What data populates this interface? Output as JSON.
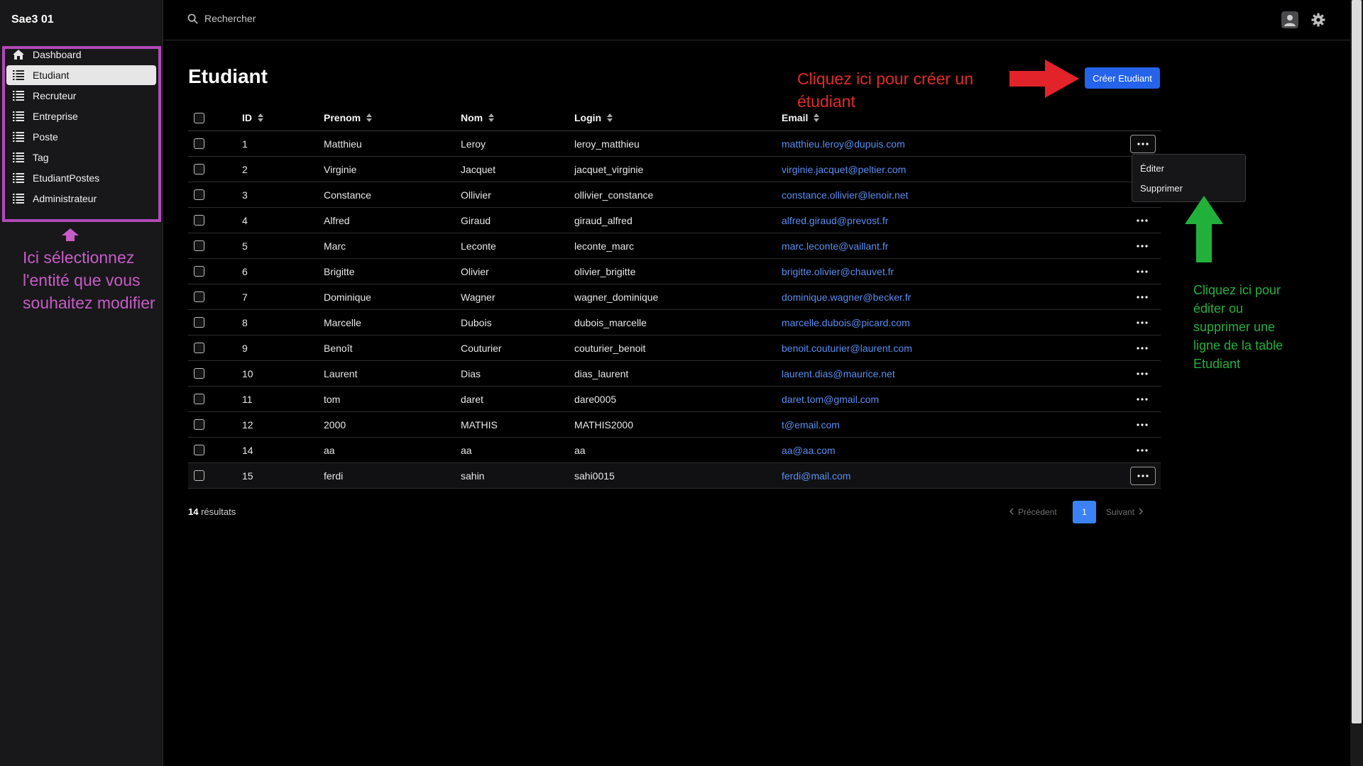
{
  "app": {
    "title": "Sae3 01"
  },
  "search": {
    "label": "Rechercher"
  },
  "sidebar": {
    "items": [
      {
        "label": "Dashboard",
        "icon": "home-icon"
      },
      {
        "label": "Etudiant",
        "icon": "list-icon",
        "active": true
      },
      {
        "label": "Recruteur",
        "icon": "list-icon"
      },
      {
        "label": "Entreprise",
        "icon": "list-icon"
      },
      {
        "label": "Poste",
        "icon": "list-icon"
      },
      {
        "label": "Tag",
        "icon": "list-icon"
      },
      {
        "label": "EtudiantPostes",
        "icon": "list-icon"
      },
      {
        "label": "Administrateur",
        "icon": "list-icon"
      }
    ]
  },
  "page": {
    "title": "Etudiant",
    "create_button": "Créer Etudiant"
  },
  "table": {
    "columns": [
      "ID",
      "Prenom",
      "Nom",
      "Login",
      "Email"
    ],
    "rows": [
      {
        "id": "1",
        "prenom": "Matthieu",
        "nom": "Leroy",
        "login": "leroy_matthieu",
        "email": "matthieu.leroy@dupuis.com"
      },
      {
        "id": "2",
        "prenom": "Virginie",
        "nom": "Jacquet",
        "login": "jacquet_virginie",
        "email": "virginie.jacquet@peltier.com"
      },
      {
        "id": "3",
        "prenom": "Constance",
        "nom": "Ollivier",
        "login": "ollivier_constance",
        "email": "constance.ollivier@lenoir.net"
      },
      {
        "id": "4",
        "prenom": "Alfred",
        "nom": "Giraud",
        "login": "giraud_alfred",
        "email": "alfred.giraud@prevost.fr"
      },
      {
        "id": "5",
        "prenom": "Marc",
        "nom": "Leconte",
        "login": "leconte_marc",
        "email": "marc.leconte@vaillant.fr"
      },
      {
        "id": "6",
        "prenom": "Brigitte",
        "nom": "Olivier",
        "login": "olivier_brigitte",
        "email": "brigitte.olivier@chauvet.fr"
      },
      {
        "id": "7",
        "prenom": "Dominique",
        "nom": "Wagner",
        "login": "wagner_dominique",
        "email": "dominique.wagner@becker.fr"
      },
      {
        "id": "8",
        "prenom": "Marcelle",
        "nom": "Dubois",
        "login": "dubois_marcelle",
        "email": "marcelle.dubois@picard.com"
      },
      {
        "id": "9",
        "prenom": "Benoît",
        "nom": "Couturier",
        "login": "couturier_benoit",
        "email": "benoit.couturier@laurent.com"
      },
      {
        "id": "10",
        "prenom": "Laurent",
        "nom": "Dias",
        "login": "dias_laurent",
        "email": "laurent.dias@maurice.net"
      },
      {
        "id": "11",
        "prenom": "tom",
        "nom": "daret",
        "login": "dare0005",
        "email": "daret.tom@gmail.com"
      },
      {
        "id": "12",
        "prenom": "2000",
        "nom": "MATHIS",
        "login": "MATHIS2000",
        "email": "t@email.com"
      },
      {
        "id": "14",
        "prenom": "aa",
        "nom": "aa",
        "login": "aa",
        "email": "aa@aa.com"
      },
      {
        "id": "15",
        "prenom": "ferdi",
        "nom": "sahin",
        "login": "sahi0015",
        "email": "ferdi@mail.com"
      }
    ],
    "row_menu": {
      "edit": "Éditer",
      "delete": "Supprimer"
    }
  },
  "footer": {
    "count": "14",
    "results_label": "résultats",
    "prev": "Précédent",
    "next": "Suivant",
    "page": "1"
  },
  "annotations": {
    "sidebar_note": "Ici sélectionnez l'entité que vous souhaitez modifier",
    "create_note": "Cliquez ici pour créer un étudiant",
    "row_note": "Cliquez ici pour éditer ou supprimer une ligne de la table Etudiant"
  },
  "colors": {
    "accent": "#2563eb",
    "link": "#5b8ef0",
    "annotation_purple": "#c85cc8",
    "annotation_red": "#e32a2a",
    "annotation_green": "#25b03c"
  }
}
